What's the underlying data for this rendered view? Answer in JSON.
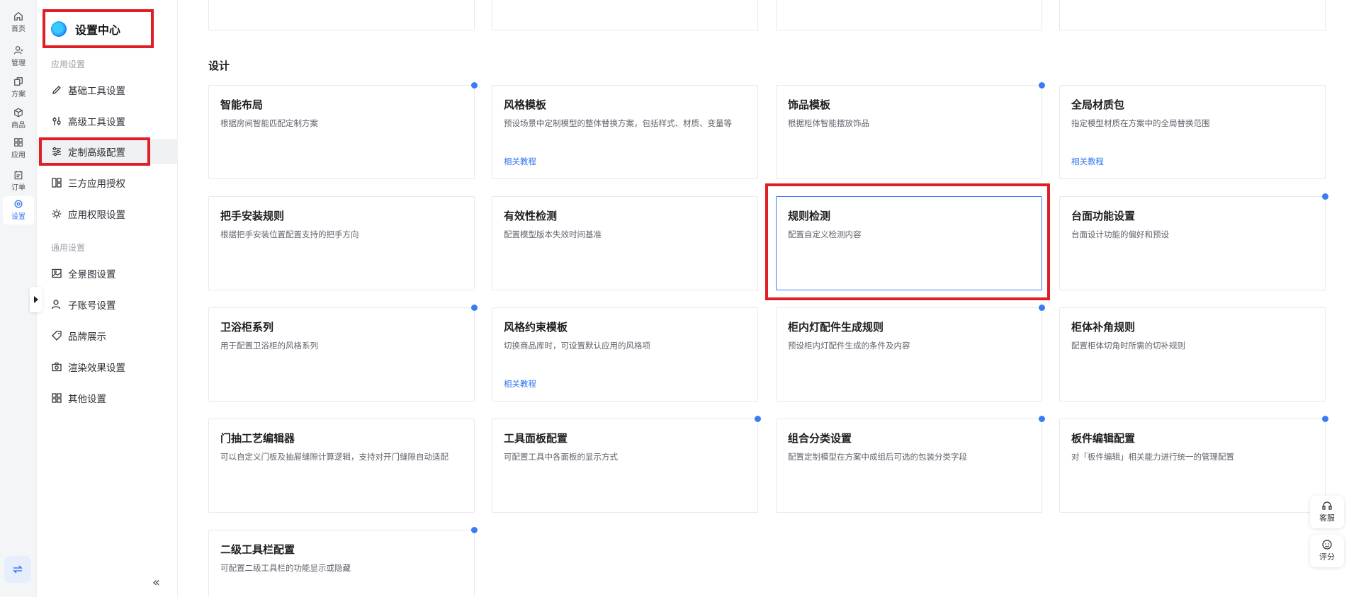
{
  "rail": {
    "items": [
      {
        "label": "首页",
        "icon": "home-icon"
      },
      {
        "label": "管理",
        "icon": "user-manage-icon"
      },
      {
        "label": "方案",
        "icon": "copy-icon"
      },
      {
        "label": "商品",
        "icon": "box-icon"
      },
      {
        "label": "应用",
        "icon": "apps-icon"
      },
      {
        "label": "订单",
        "icon": "clipboard-icon"
      },
      {
        "label": "设置",
        "icon": "settings-icon"
      }
    ]
  },
  "sidebar": {
    "title": "设置中心",
    "app_group": "应用设置",
    "general_group": "通用设置",
    "app_items": [
      {
        "label": "基础工具设置"
      },
      {
        "label": "高级工具设置"
      },
      {
        "label": "定制高级配置"
      },
      {
        "label": "三方应用授权"
      },
      {
        "label": "应用权限设置"
      }
    ],
    "general_items": [
      {
        "label": "全景图设置"
      },
      {
        "label": "子账号设置"
      },
      {
        "label": "品牌展示"
      },
      {
        "label": "渲染效果设置"
      },
      {
        "label": "其他设置"
      }
    ],
    "collapse_label": "«"
  },
  "main": {
    "section_title": "设计",
    "cards": [
      {
        "title": "智能布局",
        "desc": "根据房间智能匹配定制方案",
        "link": "",
        "dot": true
      },
      {
        "title": "风格模板",
        "desc": "预设场景中定制模型的整体替换方案，包括样式、材质、变量等",
        "link": "相关教程",
        "dot": false
      },
      {
        "title": "饰品模板",
        "desc": "根据柜体智能摆放饰品",
        "link": "",
        "dot": true
      },
      {
        "title": "全局材质包",
        "desc": "指定模型材质在方案中的全局替换范围",
        "link": "相关教程",
        "dot": false
      },
      {
        "title": "把手安装规则",
        "desc": "根据把手安装位置配置支持的把手方向",
        "link": "",
        "dot": false
      },
      {
        "title": "有效性检测",
        "desc": "配置模型版本失效时间基准",
        "link": "",
        "dot": false
      },
      {
        "title": "规则检测",
        "desc": "配置自定义检测内容",
        "link": "",
        "dot": false
      },
      {
        "title": "台面功能设置",
        "desc": "台面设计功能的偏好和预设",
        "link": "",
        "dot": true
      },
      {
        "title": "卫浴柜系列",
        "desc": "用于配置卫浴柜的风格系列",
        "link": "",
        "dot": true
      },
      {
        "title": "风格约束模板",
        "desc": "切换商品库时，可设置默认应用的风格项",
        "link": "相关教程",
        "dot": false
      },
      {
        "title": "柜内灯配件生成规则",
        "desc": "预设柜内灯配件生成的条件及内容",
        "link": "",
        "dot": true
      },
      {
        "title": "柜体补角规则",
        "desc": "配置柜体切角时所需的切补规则",
        "link": "",
        "dot": false
      },
      {
        "title": "门抽工艺编辑器",
        "desc": "可以自定义门板及抽屉缝隙计算逻辑，支持对开门缝隙自动适配",
        "link": "",
        "dot": false
      },
      {
        "title": "工具面板配置",
        "desc": "可配置工具中各面板的显示方式",
        "link": "",
        "dot": true
      },
      {
        "title": "组合分类设置",
        "desc": "配置定制模型在方案中成组后可选的包装分类字段",
        "link": "",
        "dot": true
      },
      {
        "title": "板件编辑配置",
        "desc": "对「板件编辑」相关能力进行统一的管理配置",
        "link": "",
        "dot": true
      },
      {
        "title": "二级工具栏配置",
        "desc": "可配置二级工具栏的功能显示或隐藏",
        "link": "",
        "dot": true
      }
    ]
  },
  "float": {
    "service_label": "客服",
    "rate_label": "评分"
  },
  "colors": {
    "accent": "#3a7bf6",
    "highlight": "#e01e26"
  }
}
